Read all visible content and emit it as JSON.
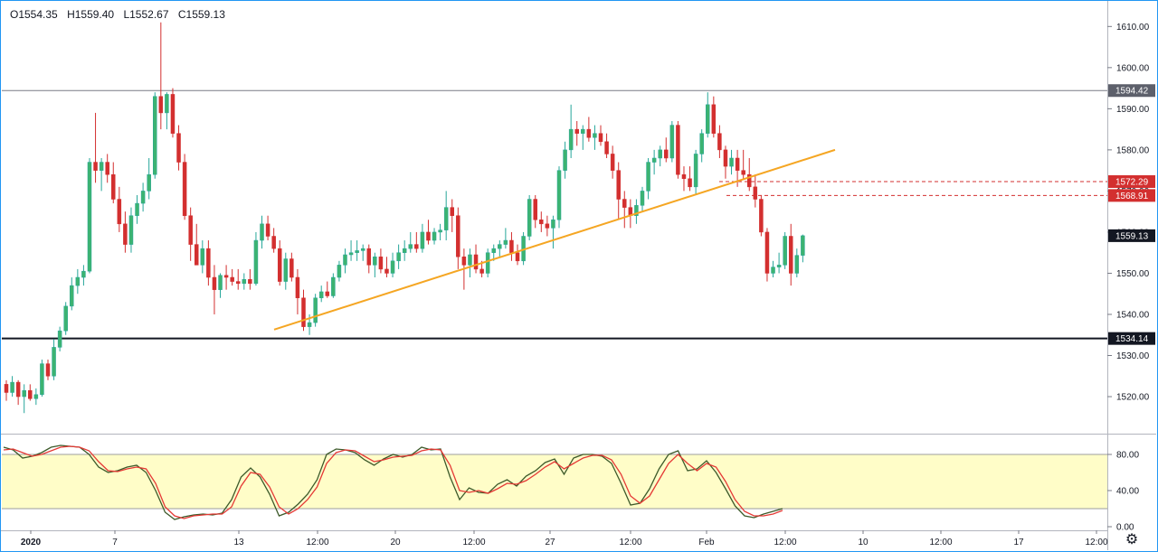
{
  "legend": {
    "open": "O1554.35",
    "high": "H1559.40",
    "low": "L1552.67",
    "close": "C1559.13"
  },
  "settings_icon": "gear-icon",
  "colors": {
    "up": "#26a69a",
    "up_fill": "#3cb371",
    "down": "#d32f2f",
    "trendline": "#f5a623",
    "stoch_k": "#3d5a2a",
    "stoch_d": "#e53935",
    "band": "#fffdc8",
    "border": "#2196f3"
  },
  "chart_data": [
    {
      "type": "candlestick",
      "ylim": [
        1511,
        1616
      ],
      "y_ticks": [
        "1520.00",
        "1530.00",
        "1540.00",
        "1550.00",
        "1560.00",
        "1570.00",
        "1580.00",
        "1590.00",
        "1600.00",
        "1610.00"
      ],
      "x_ticks": [
        "2020",
        "7",
        "13",
        "12:00",
        "20",
        "12:00",
        "27",
        "12:00",
        "Feb",
        "12:00",
        "10",
        "12:00",
        "17",
        "12:00"
      ],
      "horizontal_levels": [
        {
          "value": 1594.42,
          "label": "1594.42",
          "style": "thin-gray"
        },
        {
          "value": 1534.14,
          "label": "1534.14",
          "style": "thick-black"
        }
      ],
      "dashed_levels": [
        {
          "value": 1572.29,
          "label": "1572.29"
        },
        {
          "value": 1568.91,
          "label": "1568.91"
        }
      ],
      "last_price": {
        "value": 1559.13,
        "label": "1559.13"
      },
      "trendline": {
        "from": [
          0,
          1536.3
        ],
        "to": [
          153,
          1580.0
        ]
      },
      "candles": [
        [
          1523.0,
          1524.0,
          1519.0,
          1521.0
        ],
        [
          1521.0,
          1525.0,
          1520.0,
          1523.5
        ],
        [
          1523.5,
          1524.0,
          1518.0,
          1520.0
        ],
        [
          1520.0,
          1523.0,
          1516.0,
          1521.5
        ],
        [
          1521.5,
          1523.0,
          1519.0,
          1519.5
        ],
        [
          1519.5,
          1522.0,
          1518.0,
          1520.5
        ],
        [
          1520.5,
          1529.0,
          1520.0,
          1528.0
        ],
        [
          1528.0,
          1529.0,
          1524.0,
          1525.0
        ],
        [
          1525.0,
          1534.0,
          1524.0,
          1532.0
        ],
        [
          1532.0,
          1537.0,
          1531.0,
          1536.0
        ],
        [
          1536.0,
          1543.0,
          1535.0,
          1542.0
        ],
        [
          1542.0,
          1549.0,
          1541.0,
          1547.0
        ],
        [
          1547.0,
          1551.0,
          1545.0,
          1549.0
        ],
        [
          1549.0,
          1552.0,
          1547.0,
          1550.5
        ],
        [
          1550.5,
          1578.0,
          1550.0,
          1577.0
        ],
        [
          1577.0,
          1589.0,
          1572.0,
          1575.0
        ],
        [
          1575.0,
          1578.0,
          1570.0,
          1577.0
        ],
        [
          1577.0,
          1579.0,
          1572.0,
          1574.0
        ],
        [
          1574.0,
          1577.0,
          1567.0,
          1568.0
        ],
        [
          1568.0,
          1571.0,
          1560.0,
          1562.0
        ],
        [
          1562.0,
          1565.0,
          1555.0,
          1557.0
        ],
        [
          1557.0,
          1566.0,
          1555.0,
          1564.0
        ],
        [
          1564.0,
          1569.0,
          1562.0,
          1567.0
        ],
        [
          1567.0,
          1572.0,
          1565.0,
          1570.0
        ],
        [
          1570.0,
          1578.0,
          1568.0,
          1574.0
        ],
        [
          1574.0,
          1594.0,
          1573.0,
          1593.0
        ],
        [
          1593.0,
          1611.0,
          1585.0,
          1589.0
        ],
        [
          1589.0,
          1594.0,
          1585.0,
          1593.5
        ],
        [
          1593.5,
          1595.0,
          1583.0,
          1584.0
        ],
        [
          1584.0,
          1586.0,
          1575.0,
          1577.0
        ],
        [
          1577.0,
          1579.0,
          1563.0,
          1564.0
        ],
        [
          1564.0,
          1566.0,
          1553.0,
          1557.0
        ],
        [
          1557.0,
          1562.0,
          1552.0,
          1552.0
        ],
        [
          1552.0,
          1558.0,
          1550.0,
          1556.0
        ],
        [
          1556.0,
          1558.0,
          1547.0,
          1549.0
        ],
        [
          1549.0,
          1552.0,
          1540.0,
          1546.0
        ],
        [
          1546.0,
          1550.0,
          1544.0,
          1549.5
        ],
        [
          1549.5,
          1552.0,
          1546.0,
          1549.0
        ],
        [
          1549.0,
          1551.0,
          1547.0,
          1548.0
        ],
        [
          1548.0,
          1551.0,
          1546.0,
          1547.5
        ],
        [
          1547.5,
          1550.0,
          1546.0,
          1548.5
        ],
        [
          1548.5,
          1551.0,
          1546.0,
          1547.5
        ],
        [
          1547.5,
          1560.0,
          1547.0,
          1558.0
        ],
        [
          1558.0,
          1564.0,
          1556.0,
          1562.0
        ],
        [
          1562.0,
          1564.0,
          1558.0,
          1559.0
        ],
        [
          1559.0,
          1561.0,
          1555.0,
          1556.0
        ],
        [
          1556.0,
          1558.0,
          1547.0,
          1548.0
        ],
        [
          1548.0,
          1555.0,
          1546.0,
          1553.5
        ],
        [
          1553.5,
          1555.0,
          1548.0,
          1549.0
        ],
        [
          1549.0,
          1551.0,
          1540.0,
          1544.0
        ],
        [
          1544.0,
          1546.0,
          1536.0,
          1537.0
        ],
        [
          1537.0,
          1540.0,
          1535.0,
          1538.0
        ],
        [
          1538.0,
          1545.0,
          1537.0,
          1544.0
        ],
        [
          1544.0,
          1547.0,
          1543.0,
          1545.5
        ],
        [
          1545.5,
          1548.0,
          1544.0,
          1544.5
        ],
        [
          1544.5,
          1550.0,
          1544.0,
          1549.0
        ],
        [
          1549.0,
          1553.0,
          1548.0,
          1552.0
        ],
        [
          1552.0,
          1556.0,
          1550.0,
          1554.5
        ],
        [
          1554.5,
          1558.0,
          1553.0,
          1555.0
        ],
        [
          1555.0,
          1558.0,
          1553.0,
          1555.5
        ],
        [
          1555.5,
          1557.0,
          1553.0,
          1556.0
        ],
        [
          1556.0,
          1557.0,
          1550.0,
          1552.0
        ],
        [
          1552.0,
          1555.0,
          1549.0,
          1554.0
        ],
        [
          1554.0,
          1556.0,
          1550.0,
          1551.0
        ],
        [
          1551.0,
          1554.0,
          1549.0,
          1550.0
        ],
        [
          1550.0,
          1555.0,
          1549.0,
          1553.0
        ],
        [
          1553.0,
          1557.0,
          1551.0,
          1555.0
        ],
        [
          1555.0,
          1558.0,
          1553.0,
          1556.0
        ],
        [
          1556.0,
          1560.0,
          1555.0,
          1557.0
        ],
        [
          1557.0,
          1560.0,
          1555.0,
          1556.0
        ],
        [
          1556.0,
          1562.0,
          1555.0,
          1560.0
        ],
        [
          1560.0,
          1563.0,
          1557.0,
          1558.0
        ],
        [
          1558.0,
          1561.0,
          1557.0,
          1560.0
        ],
        [
          1560.0,
          1562.0,
          1558.0,
          1560.5
        ],
        [
          1560.5,
          1570.0,
          1558.0,
          1566.0
        ],
        [
          1566.0,
          1568.0,
          1560.0,
          1564.0
        ],
        [
          1564.0,
          1566.0,
          1551.0,
          1554.0
        ],
        [
          1554.0,
          1556.0,
          1546.0,
          1552.0
        ],
        [
          1552.0,
          1556.0,
          1549.0,
          1554.5
        ],
        [
          1554.5,
          1557.0,
          1550.0,
          1551.0
        ],
        [
          1551.0,
          1553.0,
          1549.0,
          1550.0
        ],
        [
          1550.0,
          1556.0,
          1549.0,
          1555.0
        ],
        [
          1555.0,
          1557.0,
          1553.0,
          1556.0
        ],
        [
          1556.0,
          1558.0,
          1554.0,
          1557.0
        ],
        [
          1557.0,
          1561.0,
          1556.0,
          1558.0
        ],
        [
          1558.0,
          1560.0,
          1553.0,
          1555.0
        ],
        [
          1555.0,
          1557.0,
          1552.0,
          1553.0
        ],
        [
          1553.0,
          1560.0,
          1552.0,
          1559.0
        ],
        [
          1559.0,
          1569.0,
          1558.0,
          1568.0
        ],
        [
          1568.0,
          1569.0,
          1561.0,
          1563.0
        ],
        [
          1563.0,
          1565.0,
          1560.0,
          1562.0
        ],
        [
          1562.0,
          1564.0,
          1559.0,
          1561.0
        ],
        [
          1561.0,
          1564.0,
          1556.0,
          1563.0
        ],
        [
          1563.0,
          1576.0,
          1561.0,
          1575.0
        ],
        [
          1575.0,
          1582.0,
          1573.0,
          1580.0
        ],
        [
          1580.0,
          1591.0,
          1578.0,
          1585.0
        ],
        [
          1585.0,
          1587.0,
          1581.0,
          1584.0
        ],
        [
          1584.0,
          1586.0,
          1580.0,
          1585.0
        ],
        [
          1585.0,
          1588.0,
          1582.0,
          1583.0
        ],
        [
          1583.0,
          1586.0,
          1580.0,
          1584.0
        ],
        [
          1584.0,
          1586.0,
          1581.0,
          1582.0
        ],
        [
          1582.0,
          1584.0,
          1578.0,
          1579.0
        ],
        [
          1579.0,
          1581.0,
          1573.0,
          1575.0
        ],
        [
          1575.0,
          1577.0,
          1563.0,
          1568.0
        ],
        [
          1568.0,
          1570.0,
          1561.0,
          1566.0
        ],
        [
          1566.0,
          1568.0,
          1561.0,
          1564.0
        ],
        [
          1564.0,
          1568.0,
          1562.0,
          1566.5
        ],
        [
          1566.5,
          1571.0,
          1565.0,
          1570.0
        ],
        [
          1570.0,
          1578.0,
          1568.0,
          1577.0
        ],
        [
          1577.0,
          1580.0,
          1574.0,
          1578.0
        ],
        [
          1578.0,
          1581.0,
          1576.0,
          1580.0
        ],
        [
          1580.0,
          1583.0,
          1577.0,
          1578.0
        ],
        [
          1578.0,
          1587.0,
          1577.0,
          1586.0
        ],
        [
          1586.0,
          1587.0,
          1573.0,
          1574.0
        ],
        [
          1574.0,
          1576.0,
          1570.0,
          1573.0
        ],
        [
          1573.0,
          1576.0,
          1570.0,
          1571.0
        ],
        [
          1571.0,
          1580.0,
          1569.0,
          1579.0
        ],
        [
          1579.0,
          1585.0,
          1577.0,
          1584.0
        ],
        [
          1584.0,
          1594.0,
          1583.0,
          1591.0
        ],
        [
          1591.0,
          1593.0,
          1583.0,
          1584.0
        ],
        [
          1584.0,
          1586.0,
          1578.0,
          1580.0
        ],
        [
          1580.0,
          1581.0,
          1573.0,
          1576.0
        ],
        [
          1576.0,
          1580.0,
          1574.0,
          1578.0
        ],
        [
          1578.0,
          1580.0,
          1571.0,
          1575.0
        ],
        [
          1575.0,
          1580.0,
          1573.0,
          1574.0
        ],
        [
          1574.0,
          1578.0,
          1570.0,
          1571.0
        ],
        [
          1571.0,
          1574.0,
          1566.0,
          1568.0
        ],
        [
          1568.0,
          1569.0,
          1559.0,
          1560.0
        ],
        [
          1560.0,
          1561.0,
          1548.0,
          1550.0
        ],
        [
          1550.0,
          1553.0,
          1549.0,
          1551.5
        ],
        [
          1551.5,
          1555.0,
          1550.0,
          1552.0
        ],
        [
          1552.0,
          1560.0,
          1551.0,
          1559.0
        ],
        [
          1559.0,
          1562.0,
          1547.0,
          1550.0
        ],
        [
          1550.0,
          1556.0,
          1549.0,
          1554.35
        ],
        [
          1554.35,
          1559.4,
          1552.67,
          1559.13
        ]
      ]
    },
    {
      "type": "line",
      "name": "",
      "ylim": [
        -4,
        102
      ],
      "y_ticks": [
        "0.00",
        "40.00",
        "80.00"
      ],
      "band": [
        20,
        80
      ],
      "series": [
        {
          "role": "k",
          "values": [
            88,
            85,
            76,
            78,
            82,
            88,
            90,
            89,
            88,
            80,
            66,
            60,
            62,
            66,
            68,
            60,
            40,
            16,
            8,
            11,
            13,
            14,
            13,
            15,
            30,
            55,
            65,
            55,
            36,
            12,
            16,
            25,
            36,
            52,
            80,
            86,
            85,
            82,
            74,
            68,
            75,
            80,
            77,
            80,
            88,
            85,
            86,
            55,
            30,
            43,
            38,
            37,
            47,
            52,
            45,
            56,
            62,
            71,
            75,
            58,
            76,
            80,
            80,
            78,
            70,
            48,
            24,
            26,
            42,
            64,
            80,
            84,
            62,
            64,
            73,
            60,
            42,
            23,
            12,
            10,
            14,
            17,
            20
          ]
        },
        {
          "role": "d",
          "values": [
            85,
            86,
            82,
            78,
            80,
            84,
            88,
            89,
            88,
            84,
            72,
            62,
            61,
            64,
            66,
            64,
            48,
            22,
            12,
            9,
            12,
            13,
            14,
            14,
            22,
            45,
            60,
            58,
            44,
            22,
            14,
            20,
            30,
            44,
            70,
            82,
            85,
            84,
            78,
            72,
            74,
            77,
            78,
            79,
            84,
            86,
            85,
            68,
            40,
            38,
            40,
            37,
            42,
            48,
            47,
            51,
            58,
            66,
            72,
            64,
            70,
            76,
            79,
            79,
            74,
            58,
            34,
            26,
            34,
            52,
            70,
            80,
            70,
            62,
            70,
            66,
            50,
            30,
            17,
            12,
            12,
            14,
            18
          ]
        }
      ]
    }
  ]
}
